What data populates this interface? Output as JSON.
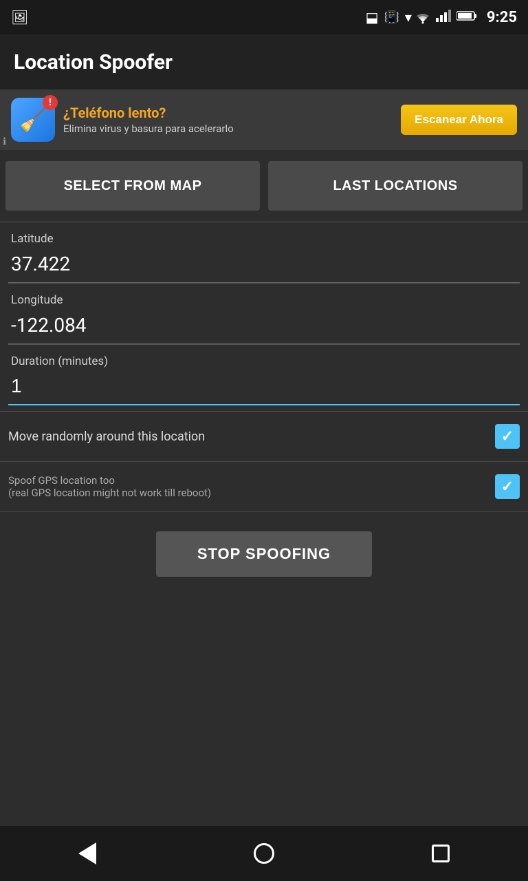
{
  "statusBar": {
    "time": "9:25",
    "icons": [
      "bluetooth",
      "vibrate",
      "wifi",
      "signal",
      "battery"
    ]
  },
  "appBar": {
    "title": "Location Spoofer"
  },
  "ad": {
    "title": "¿Teléfono lento?",
    "subtitle": "Elimina virus y basura para acelerarlo",
    "buttonLabel": "Escanear Ahora",
    "badgeText": "!",
    "infoIcon": "ℹ"
  },
  "buttons": {
    "selectFromMap": "SELECT FROM MAP",
    "lastLocations": "LAST LOCATIONS"
  },
  "fields": {
    "latitudeLabel": "Latitude",
    "latitudeValue": "37.422",
    "longitudeLabel": "Longitude",
    "longitudeValue": "-122.084",
    "durationLabel": "Duration (minutes)",
    "durationValue": "1"
  },
  "checkboxes": {
    "moveRandomly": {
      "label": "Move randomly around this location",
      "checked": true
    },
    "spoofGPS": {
      "label": "Spoof GPS location too",
      "subLabel": "(real GPS location might not work till reboot)",
      "checked": true
    }
  },
  "stopButton": "STOP SPOOFING",
  "navbar": {
    "back": "back",
    "home": "home",
    "recent": "recent"
  }
}
